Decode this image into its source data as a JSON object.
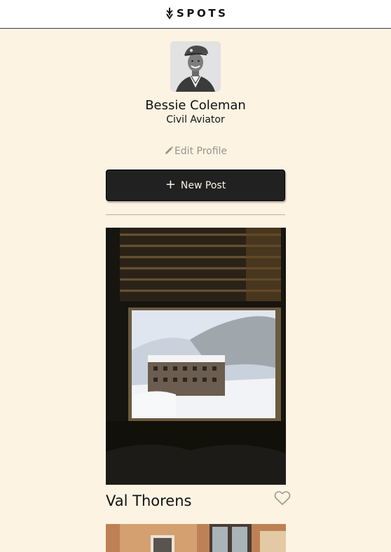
{
  "header": {
    "logo_text": "SPOTS",
    "logo_icon": "arrow-down-mark-icon"
  },
  "profile": {
    "name": "Bessie Coleman",
    "description": "Civil Aviator",
    "avatar_icon": "profile-photo",
    "edit_label": "Edit Profile",
    "edit_icon": "pencil-icon"
  },
  "actions": {
    "new_post_label": "New Post",
    "new_post_icon": "plus-icon"
  },
  "cards": [
    {
      "title": "Val Thorens",
      "image_description": "snowy-village-through-window",
      "liked": false,
      "like_icon": "heart-outline-icon"
    },
    {
      "title": "",
      "image_description": "building-facade"
    }
  ],
  "colors": {
    "page_background": "#fcf3e3",
    "header_background": "#ffffff",
    "text": "#121212",
    "muted_text": "#999287",
    "button_background": "#212121",
    "button_text": "#fcf5e5"
  }
}
